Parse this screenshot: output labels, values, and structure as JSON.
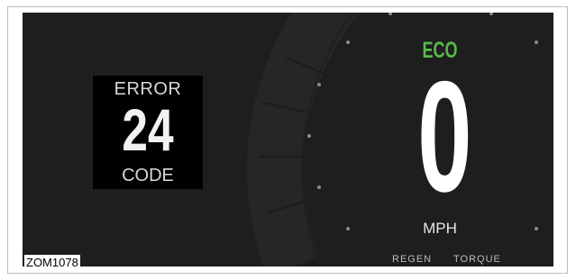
{
  "display": {
    "error": {
      "top_label": "ERROR",
      "code": "24",
      "bottom_label": "CODE"
    },
    "mode": "ECO",
    "speed": "0",
    "unit": "MPH",
    "bottom_labels": {
      "regen": "REGEN",
      "torque": "TORQUE"
    }
  },
  "figure_label": "ZOM1078",
  "colors": {
    "screen_background": "#1e1e1e",
    "error_box_background": "#000000",
    "mode_text": "#59b84a",
    "speed_text": "#ffffff",
    "gauge_arc": "#262626",
    "tick_dots": "#8c8c8c"
  }
}
